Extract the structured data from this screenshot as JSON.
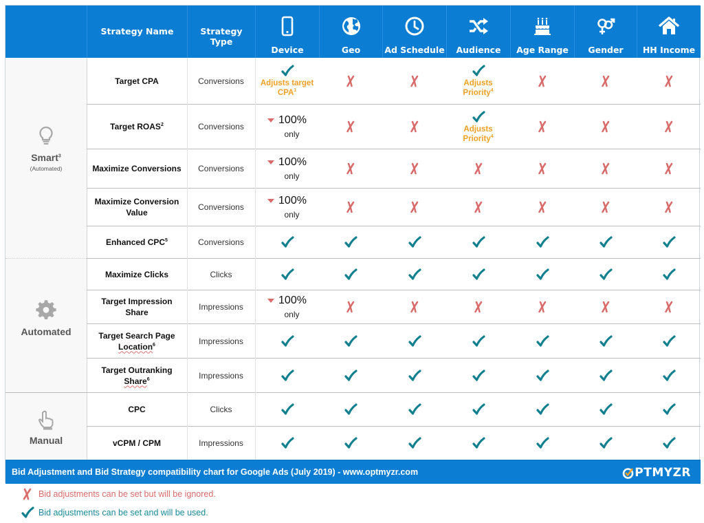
{
  "colors": {
    "header_bg": "#0b7dd3",
    "check": "#13808f",
    "cross": "#d96b6b",
    "note": "#f0a023",
    "group_bg": "#f8f8f8"
  },
  "header": {
    "columns": [
      {
        "label": "",
        "icon": null
      },
      {
        "label": "Strategy Name",
        "icon": null
      },
      {
        "label": "Strategy Type",
        "icon": null
      },
      {
        "label": "Device",
        "icon": "mobile-phone-icon"
      },
      {
        "label": "Geo",
        "icon": "globe-icon"
      },
      {
        "label": "Ad Schedule",
        "icon": "clock-icon"
      },
      {
        "label": "Audience",
        "icon": "shuffle-icon"
      },
      {
        "label": "Age Range",
        "icon": "birthday-cake-icon"
      },
      {
        "label": "Gender",
        "icon": "gender-icon"
      },
      {
        "label": "HH  Income",
        "icon": "house-icon"
      }
    ]
  },
  "groups": [
    {
      "name": "Smart",
      "sup": "3",
      "sub": "(Automated)",
      "icon": "lightbulb-icon"
    },
    {
      "name": "Automated",
      "sup": "",
      "sub": "",
      "icon": "gear-icon"
    },
    {
      "name": "Manual",
      "sup": "",
      "sub": "",
      "icon": "pointing-hand-icon"
    }
  ],
  "rows": [
    {
      "group": 0,
      "name": "Target CPA",
      "sup": "",
      "type": "Conversions",
      "cells": [
        {
          "kind": "check",
          "note": "Adjusts target CPA",
          "note_sup": "1"
        },
        {
          "kind": "cross"
        },
        {
          "kind": "cross"
        },
        {
          "kind": "check",
          "note": "Adjusts Priority",
          "note_sup": "4"
        },
        {
          "kind": "cross"
        },
        {
          "kind": "cross"
        },
        {
          "kind": "cross"
        }
      ]
    },
    {
      "group": 0,
      "name": "Target ROAS",
      "sup": "2",
      "type": "Conversions",
      "cells": [
        {
          "kind": "pct",
          "value": "100%",
          "sub": "only"
        },
        {
          "kind": "cross"
        },
        {
          "kind": "cross"
        },
        {
          "kind": "check",
          "note": "Adjusts Priority",
          "note_sup": "4"
        },
        {
          "kind": "cross"
        },
        {
          "kind": "cross"
        },
        {
          "kind": "cross"
        }
      ]
    },
    {
      "group": 0,
      "name": "Maximize Conversions",
      "sup": "",
      "type": "Conversions",
      "cells": [
        {
          "kind": "pct",
          "value": "100%",
          "sub": "only"
        },
        {
          "kind": "cross"
        },
        {
          "kind": "cross"
        },
        {
          "kind": "cross"
        },
        {
          "kind": "cross"
        },
        {
          "kind": "cross"
        },
        {
          "kind": "cross"
        }
      ]
    },
    {
      "group": 0,
      "name": "Maximize Conversion Value",
      "sup": "",
      "type": "Conversions",
      "cells": [
        {
          "kind": "pct",
          "value": "100%",
          "sub": "only"
        },
        {
          "kind": "cross"
        },
        {
          "kind": "cross"
        },
        {
          "kind": "cross"
        },
        {
          "kind": "cross"
        },
        {
          "kind": "cross"
        },
        {
          "kind": "cross"
        }
      ]
    },
    {
      "group": 0,
      "name": "Enhanced CPC",
      "sup": "5",
      "type": "Conversions",
      "cells": [
        {
          "kind": "check"
        },
        {
          "kind": "check"
        },
        {
          "kind": "check"
        },
        {
          "kind": "check"
        },
        {
          "kind": "check"
        },
        {
          "kind": "check"
        },
        {
          "kind": "check"
        }
      ]
    },
    {
      "group": 1,
      "name": "Maximize Clicks",
      "sup": "",
      "type": "Clicks",
      "cells": [
        {
          "kind": "check"
        },
        {
          "kind": "check"
        },
        {
          "kind": "check"
        },
        {
          "kind": "check"
        },
        {
          "kind": "check"
        },
        {
          "kind": "check"
        },
        {
          "kind": "check"
        }
      ]
    },
    {
      "group": 1,
      "name": "Target Impression Share",
      "sup": "",
      "type": "Impressions",
      "cells": [
        {
          "kind": "pct",
          "value": "100%",
          "sub": "only"
        },
        {
          "kind": "cross"
        },
        {
          "kind": "cross"
        },
        {
          "kind": "cross"
        },
        {
          "kind": "cross"
        },
        {
          "kind": "cross"
        },
        {
          "kind": "cross"
        }
      ]
    },
    {
      "group": 1,
      "name": "Target Search Page Location",
      "sup": "6",
      "type": "Impressions",
      "squiggle": "Location",
      "cells": [
        {
          "kind": "check"
        },
        {
          "kind": "check"
        },
        {
          "kind": "check"
        },
        {
          "kind": "check"
        },
        {
          "kind": "check"
        },
        {
          "kind": "check"
        },
        {
          "kind": "check"
        }
      ]
    },
    {
      "group": 1,
      "name": "Target Outranking Share",
      "sup": "6",
      "type": "Impressions",
      "squiggle": "Share",
      "cells": [
        {
          "kind": "check"
        },
        {
          "kind": "check"
        },
        {
          "kind": "check"
        },
        {
          "kind": "check"
        },
        {
          "kind": "check"
        },
        {
          "kind": "check"
        },
        {
          "kind": "check"
        }
      ]
    },
    {
      "group": 2,
      "name": "CPC",
      "sup": "",
      "type": "Clicks",
      "cells": [
        {
          "kind": "check"
        },
        {
          "kind": "check"
        },
        {
          "kind": "check"
        },
        {
          "kind": "check"
        },
        {
          "kind": "check"
        },
        {
          "kind": "check"
        },
        {
          "kind": "check"
        }
      ]
    },
    {
      "group": 2,
      "name": "vCPM / CPM",
      "sup": "",
      "type": "Impressions",
      "cells": [
        {
          "kind": "check"
        },
        {
          "kind": "check"
        },
        {
          "kind": "check"
        },
        {
          "kind": "check"
        },
        {
          "kind": "check"
        },
        {
          "kind": "check"
        },
        {
          "kind": "check"
        }
      ]
    }
  ],
  "footer": {
    "text": "Bid Adjustment and Bid Strategy compatibility chart for Google Ads (July 2019) - www.optmyzr.com",
    "logo_rest": "PTMYZR"
  },
  "legend": {
    "cross_text": "Bid adjustments can be set but will be ignored.",
    "check_text": "Bid adjustments can be set and will be used."
  }
}
